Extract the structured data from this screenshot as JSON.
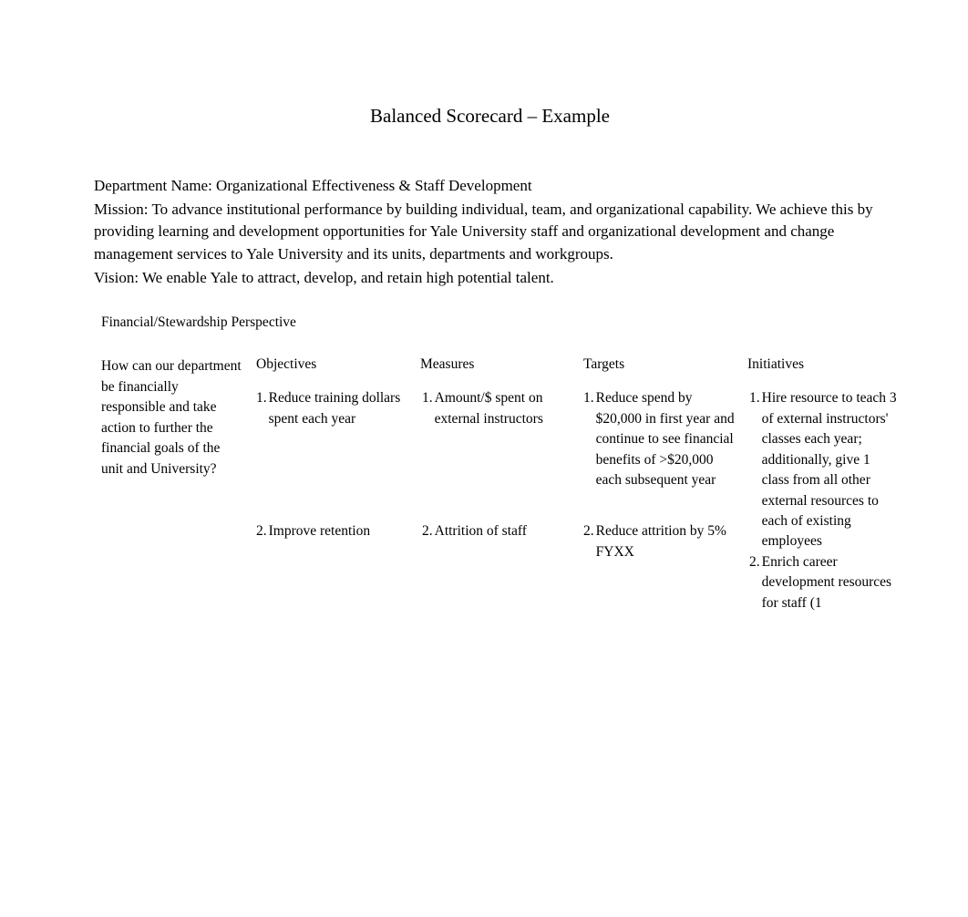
{
  "title": "Balanced Scorecard – Example",
  "header": {
    "department": "Department Name: Organizational Effectiveness & Staff Development",
    "mission": "Mission: To advance institutional performance by building individual, team, and organizational capability. We achieve this by providing learning and development opportunities for Yale University staff and organizational development and change management services to Yale University and its units, departments and workgroups.",
    "vision": "Vision: We enable Yale to attract, develop, and retain high potential talent."
  },
  "perspective": "Financial/Stewardship Perspective",
  "columns": {
    "question": "How can our department be financially responsible and take action to further the financial goals of the unit and University?",
    "objectives_header": "Objectives",
    "measures_header": "Measures",
    "targets_header": "Targets",
    "initiatives_header": "Initiatives"
  },
  "rows": [
    {
      "num": "1.",
      "num_alt": "1.",
      "objective": "Reduce training dollars spent each year",
      "measure": "Amount/$ spent on external instructors",
      "target": "Reduce spend by $20,000 in first year and continue to see financial benefits of >$20,000 each subsequent year",
      "initiative": "Hire resource to teach 3 of external instructors' classes each year; additionally, give 1 class from all other external resources to each of existing employees"
    },
    {
      "num": "2.",
      "num_alt": "2.",
      "objective": "Improve retention",
      "measure": "Attrition of staff",
      "target": "Reduce attrition by 5% FYXX",
      "initiative": "Enrich career development resources for staff (1"
    }
  ]
}
